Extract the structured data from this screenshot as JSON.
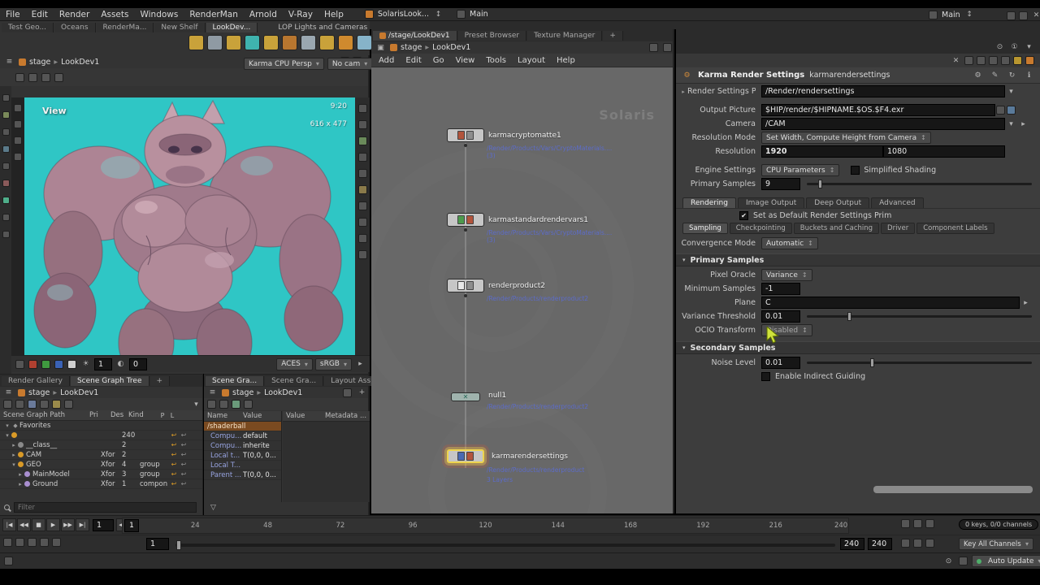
{
  "colors": {
    "viewport_teal": "#2fc6c5",
    "accent_orange": "#c87a2e",
    "selection_yellow": "#edd44e",
    "node_path_blue": "#5c6cc9",
    "cursor_green": "#cfe23c"
  },
  "icons": {
    "chev_down": "▾",
    "chev_right": "▸",
    "updown": "↕",
    "close": "✕",
    "plus": "+",
    "menu": "≡",
    "gear": "⚙",
    "pencil": "✎",
    "refresh": "↻",
    "info": "ℹ",
    "check": "✔",
    "dot": "●",
    "target": "⊙",
    "grid": "▦",
    "pin": "▣",
    "sun": "☀",
    "half": "◐",
    "funnel": "▽",
    "fav": "◆",
    "uturn": "↩",
    "one": "①",
    "to_start": "|◀",
    "rew": "◀◀",
    "stop": "■",
    "play": "▶",
    "ffwd": "▶▶",
    "to_end": "▶|",
    "prev": "◀",
    "next": "▶",
    "x_node": "✕"
  },
  "menubar": {
    "menus": [
      "File",
      "Edit",
      "Render",
      "Assets",
      "Windows",
      "RenderMan",
      "Arnold",
      "V-Ray",
      "Help"
    ],
    "desktop": "SolarisLook...",
    "pane": "Main",
    "pane_right": "Main"
  },
  "shelf": {
    "tabs": [
      "Test Geo...",
      "Oceans",
      "RenderMa...",
      "New Shelf",
      "LookDev..."
    ],
    "set_name": "LOP Lights and Cameras"
  },
  "viewport": {
    "crumb_root": "stage",
    "crumb_node": "LookDev1",
    "view_label": "View",
    "renderer": "Karma CPU Persp",
    "camera": "No cam",
    "time": "9:20",
    "res": "616 x 477",
    "exposure": "1",
    "gamma": "0",
    "lut": "ACES",
    "display": "sRGB"
  },
  "network": {
    "tabs": [
      "/stage/LookDev1",
      "Preset Browser",
      "Texture Manager"
    ],
    "crumb_root": "stage",
    "crumb_node": "LookDev1",
    "menus": [
      "Add",
      "Edit",
      "Go",
      "View",
      "Tools",
      "Layout",
      "Help"
    ],
    "watermark": "Solaris",
    "nodes": [
      {
        "name": "karmacryptomatte1",
        "path": "/Render/Products/Vars/CryptoMaterials.... (3)"
      },
      {
        "name": "karmastandardrendervars1",
        "path": "/Render/Products/Vars/CryptoMaterials.... (3)"
      },
      {
        "name": "renderproduct2",
        "path": "/Render/Products/renderproduct2"
      },
      {
        "name": "null1",
        "path": "/Render/Products/renderproduct2"
      },
      {
        "name": "karmarendersettings",
        "path": "/Render/Products/renderproduct",
        "badge": "3 Layers"
      }
    ]
  },
  "params": {
    "title": "Karma Render Settings",
    "node_name": "karmarendersettings",
    "prim_label": "Render Settings Prim",
    "prim_value": "/Render/rendersettings",
    "output_label": "Output Picture",
    "output_value": "$HIP/render/$HIPNAME.$OS.$F4.exr",
    "camera_label": "Camera",
    "camera_value": "/CAM",
    "resmode_label": "Resolution Mode",
    "resmode_value": "Set Width, Compute Height from Camera",
    "res_label": "Resolution",
    "res_w": "1920",
    "res_h": "1080",
    "engine_label": "Engine Settings",
    "engine_value": "CPU Parameters",
    "simplified_label": "Simplified Shading",
    "psamples_label": "Primary Samples",
    "psamples_value": "9",
    "tabs": [
      "Rendering",
      "Image Output",
      "Deep Output",
      "Advanced"
    ],
    "default_prim_label": "Set as Default Render Settings Prim",
    "subtabs": [
      "Sampling",
      "Checkpointing",
      "Buckets and Caching",
      "Driver",
      "Component Labels"
    ],
    "convergence_label": "Convergence Mode",
    "convergence_value": "Automatic",
    "section_primary": "Primary Samples",
    "pixel_oracle_label": "Pixel Oracle",
    "pixel_oracle_value": "Variance",
    "min_samples_label": "Minimum Samples",
    "min_samples_value": "-1",
    "plane_label": "Plane",
    "plane_value": "C",
    "variance_label": "Variance Threshold",
    "variance_value": "0.01",
    "ocio_label": "OCIO Transform",
    "ocio_value": "Disabled",
    "section_secondary": "Secondary Samples",
    "noise_label": "Noise Level",
    "noise_value": "0.01",
    "indirect_label": "Enable Indirect Guiding"
  },
  "gallery": {
    "tabs": [
      "Render Gallery",
      "Scene Graph Tree"
    ],
    "crumb_root": "stage",
    "crumb_node": "LookDev1",
    "headers": [
      "Scene Graph Path",
      "Pri",
      "Des",
      "Kind",
      "P",
      "L"
    ],
    "rows": [
      {
        "name": "Favorites",
        "pri": "",
        "des": "",
        "kind": ""
      },
      {
        "name": "",
        "pri": "",
        "des": "240",
        "kind": ""
      },
      {
        "name": "__class__",
        "pri": "",
        "des": "2",
        "kind": ""
      },
      {
        "name": "CAM",
        "pri": "Xfor",
        "des": "2",
        "kind": ""
      },
      {
        "name": "GEO",
        "pri": "Xfor",
        "des": "4",
        "kind": "group"
      },
      {
        "name": "MainModel",
        "pri": "Xfor",
        "des": "3",
        "kind": "group"
      },
      {
        "name": "Ground",
        "pri": "Xfor",
        "des": "1",
        "kind": "compon"
      }
    ],
    "filter_placeholder": "Filter"
  },
  "details": {
    "tabs": [
      "Scene Gra...",
      "Scene Gra...",
      "Layout Ass..."
    ],
    "crumb_root": "stage",
    "crumb_node": "LookDev1",
    "left_headers": [
      "Name",
      "Value"
    ],
    "right_headers": [
      "Value",
      "Metadata ..."
    ],
    "prim_row": "/shaderball",
    "rows": [
      {
        "name": "Compu...",
        "value": "default"
      },
      {
        "name": "Compu...",
        "value": "inherite"
      },
      {
        "name": "Local t...",
        "value": "T(0,0, 0..."
      },
      {
        "name": "Local T...",
        "value": ""
      },
      {
        "name": "Parent ...",
        "value": "T(0,0, 0..."
      }
    ]
  },
  "timeline": {
    "ticks": [
      "24",
      "48",
      "72",
      "96",
      "120",
      "144",
      "168",
      "192",
      "216",
      "240"
    ],
    "playhead": "1",
    "frame": "1",
    "range_start": "1",
    "range_end": "240",
    "range_end2": "240"
  },
  "keyframes": {
    "badge": "0 keys, 0/0 channels",
    "key_all": "Key All Channels"
  },
  "statusbar": {
    "auto_update": "Auto Update"
  }
}
